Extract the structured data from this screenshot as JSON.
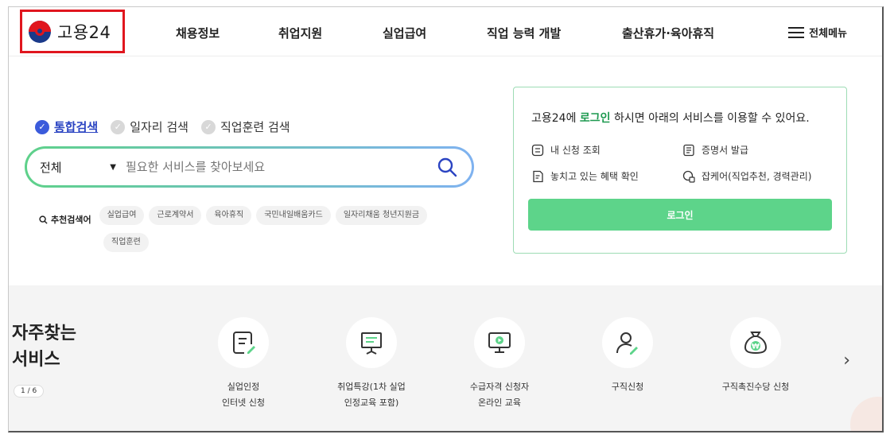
{
  "header": {
    "logo_text": "고용24",
    "nav": [
      "채용정보",
      "취업지원",
      "실업급여",
      "직업 능력 개발",
      "출산휴가·육아휴직"
    ],
    "menu_all": "전체메뉴"
  },
  "search": {
    "tabs": [
      {
        "label": "통합검색",
        "active": true
      },
      {
        "label": "일자리 검색",
        "active": false
      },
      {
        "label": "직업훈련 검색",
        "active": false
      }
    ],
    "select_value": "전체",
    "placeholder": "필요한 서비스를 찾아보세요",
    "keywords_label": "추천검색어",
    "keywords": [
      "실업급여",
      "근로계약서",
      "육아휴직",
      "국민내일배움카드",
      "일자리채움 청년지원금",
      "직업훈련"
    ]
  },
  "login": {
    "title_pre": "고용24에 ",
    "title_link": "로그인",
    "title_post": " 하시면 아래의 서비스를 이용할 수 있어요.",
    "services": [
      "내 신청 조회",
      "증명서 발급",
      "놓치고 있는 혜택 확인",
      "잡케어(직업추천, 경력관리)"
    ],
    "button": "로그인"
  },
  "frequent": {
    "title_line1": "자주찾는",
    "title_line2": "서비스",
    "pager": "1 / 6",
    "items": [
      {
        "label": "실업인정\n인터넷 신청",
        "icon": "document-pen-icon"
      },
      {
        "label": "취업특강(1차 실업\n인정교육 포함)",
        "icon": "presentation-board-icon"
      },
      {
        "label": "수급자격 신청자\n온라인 교육",
        "icon": "monitor-play-icon"
      },
      {
        "label": "구직신청",
        "icon": "person-pen-icon"
      },
      {
        "label": "구직촉진수당 신청",
        "icon": "money-bag-won-icon"
      }
    ]
  },
  "colors": {
    "accent_green": "#5dd48a",
    "accent_blue": "#2b44c2",
    "logo_red": "#e0161e",
    "logo_blue": "#1a3a8a"
  }
}
